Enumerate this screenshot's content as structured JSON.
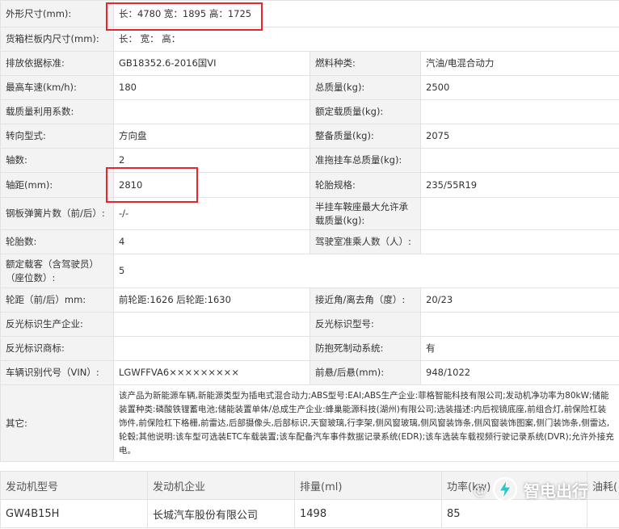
{
  "highlight_color": "#e8252a",
  "spec": {
    "dims_label": "外形尺寸(mm):",
    "dims_value": "长：4780 宽：1895 高：1725",
    "cargo_label": "货箱栏板内尺寸(mm):",
    "cargo_value": "长：  宽：  高：",
    "emission_label": "排放依据标准:",
    "emission_value": "GB18352.6-2016国VI",
    "fuel_label": "燃料种类:",
    "fuel_value": "汽油/电混合动力",
    "speed_label": "最高车速(km/h):",
    "speed_value": "180",
    "total_mass_label": "总质量(kg):",
    "total_mass_value": "2500",
    "load_util_label": "载质量利用系数:",
    "load_util_value": "",
    "rated_load_label": "额定载质量(kg):",
    "rated_load_value": "",
    "steering_label": "转向型式:",
    "steering_value": "方向盘",
    "curb_label": "整备质量(kg):",
    "curb_value": "2075",
    "axles_label": "轴数:",
    "axles_value": "2",
    "towing_label": "准拖挂车总质量(kg):",
    "towing_value": "",
    "wheelbase_label": "轴距(mm):",
    "wheelbase_value": "2810",
    "tire_label": "轮胎规格:",
    "tire_value": "235/55R19",
    "spring_label": "钢板弹簧片数（前/后）:",
    "spring_value": "-/-",
    "saddle_label": "半挂车鞍座最大允许承载质量(kg):",
    "saddle_value": "",
    "tire_count_label": "轮胎数:",
    "tire_count_value": "4",
    "cab_label": "驾驶室准乘人数（人）:",
    "cab_value": "",
    "seats_label": "额定载客（含驾驶员）（座位数）:",
    "seats_value": "5",
    "track_label": "轮距（前/后）mm:",
    "track_value": "前轮距:1626 后轮距:1630",
    "angle_label": "接近角/离去角（度）:",
    "angle_value": "20/23",
    "reflect_maker_label": "反光标识生产企业:",
    "reflect_maker_value": "",
    "reflect_model_label": "反光标识型号:",
    "reflect_model_value": "",
    "reflect_brand_label": "反光标识商标:",
    "reflect_brand_value": "",
    "abs_label": "防抱死制动系统:",
    "abs_value": "有",
    "vin_label": "车辆识别代号（VIN）:",
    "vin_value": "LGWFFVA6×××××××××",
    "overhang_label": "前悬/后悬(mm):",
    "overhang_value": "948/1022",
    "other_label": "其它:",
    "other_value": "该产品为新能源车辆,新能源类型为插电式混合动力;ABS型号:EAI;ABS生产企业:菲格智能科技有限公司;发动机净功率为80kW;储能装置种类:磷酸铁锂蓄电池;储能装置单体/总成生产企业:蜂巢能源科技(湖州)有限公司;选装描述:内后视镜底座,前组合灯,前保险杠装饰件,前保险杠下格栅,前雷达,后部摄像头,后部标识,天窗玻璃,行李架,侧风窗玻璃,侧风窗装饰条,侧风窗装饰图案,侧门装饰条,侧雷达,轮毂;其他说明:该车型可选装ETC车载装置;该车配备汽车事件数据记录系统(EDR);该车选装车载视频行驶记录系统(DVR);允许外接充电。"
  },
  "engine": {
    "headers": [
      "发动机型号",
      "发动机企业",
      "排量(ml)",
      "功率(kw)",
      "油耗("
    ],
    "row": [
      "GW4B15H",
      "长城汽车股份有限公司",
      "1498",
      "85",
      ""
    ]
  },
  "watermark": {
    "at": "@",
    "brand": "智电出行",
    "icon": "lightning-bolt-logo"
  }
}
